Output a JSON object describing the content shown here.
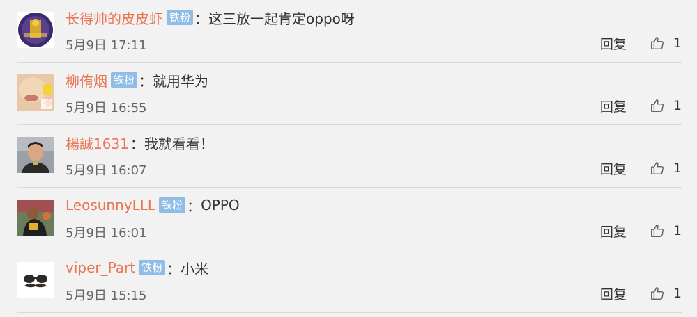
{
  "comments": [
    {
      "username": "长得帅的皮皮虾",
      "badge": "铁粉",
      "colon": "：",
      "text": "这三放一起肯定oppo呀",
      "time": "5月9日 17:11",
      "reply_label": "回复",
      "likes": "1",
      "avatar_icon": "avatar-lakers-purple"
    },
    {
      "username": "柳侑烟",
      "badge": "铁粉",
      "colon": "：",
      "text": "就用华为",
      "time": "5月9日 16:55",
      "reply_label": "回复",
      "likes": "1",
      "avatar_icon": "avatar-face-closeup"
    },
    {
      "username": "楊誠1631",
      "badge": "",
      "colon": "：",
      "text": "我就看看！",
      "time": "5月9日 16:07",
      "reply_label": "回复",
      "likes": "1",
      "avatar_icon": "avatar-man-portrait"
    },
    {
      "username": "LeosunnyLLL",
      "badge": "铁粉",
      "colon": "：",
      "text": "OPPO",
      "time": "5月9日 16:01",
      "reply_label": "回复",
      "likes": "1",
      "avatar_icon": "avatar-basketball-player"
    },
    {
      "username": "viper_Part",
      "badge": "铁粉",
      "colon": "：",
      "text": "小米",
      "time": "5月9日 15:15",
      "reply_label": "回复",
      "likes": "1",
      "avatar_icon": "avatar-mustache-glasses"
    }
  ],
  "colors": {
    "background": "#f2f2f2",
    "username": "#eb7350",
    "badge": "#8fbde8",
    "divider": "#d9d9d9"
  }
}
